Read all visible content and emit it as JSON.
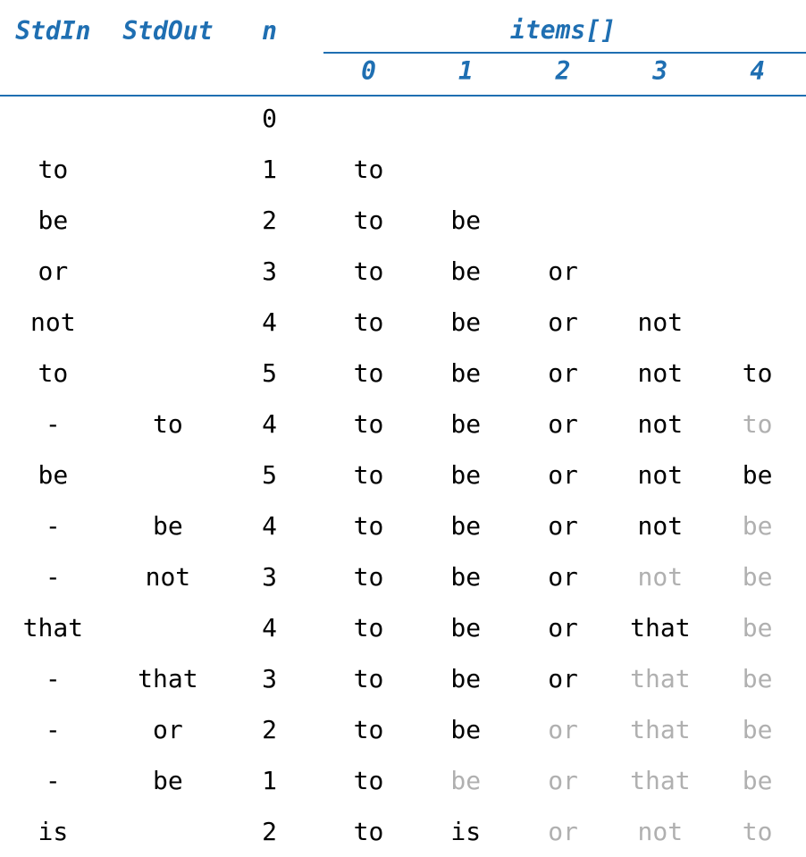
{
  "headers": {
    "stdin": "StdIn",
    "stdout": "StdOut",
    "n": "n",
    "items_label": "items[]",
    "indices": [
      "0",
      "1",
      "2",
      "3",
      "4"
    ]
  },
  "rows": [
    {
      "stdin": "",
      "stdout": "",
      "n": "0",
      "items": [
        {
          "v": "",
          "g": false
        },
        {
          "v": "",
          "g": false
        },
        {
          "v": "",
          "g": false
        },
        {
          "v": "",
          "g": false
        },
        {
          "v": "",
          "g": false
        }
      ]
    },
    {
      "stdin": "to",
      "stdout": "",
      "n": "1",
      "items": [
        {
          "v": "to",
          "g": false
        },
        {
          "v": "",
          "g": false
        },
        {
          "v": "",
          "g": false
        },
        {
          "v": "",
          "g": false
        },
        {
          "v": "",
          "g": false
        }
      ]
    },
    {
      "stdin": "be",
      "stdout": "",
      "n": "2",
      "items": [
        {
          "v": "to",
          "g": false
        },
        {
          "v": "be",
          "g": false
        },
        {
          "v": "",
          "g": false
        },
        {
          "v": "",
          "g": false
        },
        {
          "v": "",
          "g": false
        }
      ]
    },
    {
      "stdin": "or",
      "stdout": "",
      "n": "3",
      "items": [
        {
          "v": "to",
          "g": false
        },
        {
          "v": "be",
          "g": false
        },
        {
          "v": "or",
          "g": false
        },
        {
          "v": "",
          "g": false
        },
        {
          "v": "",
          "g": false
        }
      ]
    },
    {
      "stdin": "not",
      "stdout": "",
      "n": "4",
      "items": [
        {
          "v": "to",
          "g": false
        },
        {
          "v": "be",
          "g": false
        },
        {
          "v": "or",
          "g": false
        },
        {
          "v": "not",
          "g": false
        },
        {
          "v": "",
          "g": false
        }
      ]
    },
    {
      "stdin": "to",
      "stdout": "",
      "n": "5",
      "items": [
        {
          "v": "to",
          "g": false
        },
        {
          "v": "be",
          "g": false
        },
        {
          "v": "or",
          "g": false
        },
        {
          "v": "not",
          "g": false
        },
        {
          "v": "to",
          "g": false
        }
      ]
    },
    {
      "stdin": "-",
      "stdout": "to",
      "n": "4",
      "items": [
        {
          "v": "to",
          "g": false
        },
        {
          "v": "be",
          "g": false
        },
        {
          "v": "or",
          "g": false
        },
        {
          "v": "not",
          "g": false
        },
        {
          "v": "to",
          "g": true
        }
      ]
    },
    {
      "stdin": "be",
      "stdout": "",
      "n": "5",
      "items": [
        {
          "v": "to",
          "g": false
        },
        {
          "v": "be",
          "g": false
        },
        {
          "v": "or",
          "g": false
        },
        {
          "v": "not",
          "g": false
        },
        {
          "v": "be",
          "g": false
        }
      ]
    },
    {
      "stdin": "-",
      "stdout": "be",
      "n": "4",
      "items": [
        {
          "v": "to",
          "g": false
        },
        {
          "v": "be",
          "g": false
        },
        {
          "v": "or",
          "g": false
        },
        {
          "v": "not",
          "g": false
        },
        {
          "v": "be",
          "g": true
        }
      ]
    },
    {
      "stdin": "-",
      "stdout": "not",
      "n": "3",
      "items": [
        {
          "v": "to",
          "g": false
        },
        {
          "v": "be",
          "g": false
        },
        {
          "v": "or",
          "g": false
        },
        {
          "v": "not",
          "g": true
        },
        {
          "v": "be",
          "g": true
        }
      ]
    },
    {
      "stdin": "that",
      "stdout": "",
      "n": "4",
      "items": [
        {
          "v": "to",
          "g": false
        },
        {
          "v": "be",
          "g": false
        },
        {
          "v": "or",
          "g": false
        },
        {
          "v": "that",
          "g": false
        },
        {
          "v": "be",
          "g": true
        }
      ]
    },
    {
      "stdin": "-",
      "stdout": "that",
      "n": "3",
      "items": [
        {
          "v": "to",
          "g": false
        },
        {
          "v": "be",
          "g": false
        },
        {
          "v": "or",
          "g": false
        },
        {
          "v": "that",
          "g": true
        },
        {
          "v": "be",
          "g": true
        }
      ]
    },
    {
      "stdin": "-",
      "stdout": "or",
      "n": "2",
      "items": [
        {
          "v": "to",
          "g": false
        },
        {
          "v": "be",
          "g": false
        },
        {
          "v": "or",
          "g": true
        },
        {
          "v": "that",
          "g": true
        },
        {
          "v": "be",
          "g": true
        }
      ]
    },
    {
      "stdin": "-",
      "stdout": "be",
      "n": "1",
      "items": [
        {
          "v": "to",
          "g": false
        },
        {
          "v": "be",
          "g": true
        },
        {
          "v": "or",
          "g": true
        },
        {
          "v": "that",
          "g": true
        },
        {
          "v": "be",
          "g": true
        }
      ]
    },
    {
      "stdin": "is",
      "stdout": "",
      "n": "2",
      "items": [
        {
          "v": "to",
          "g": false
        },
        {
          "v": "is",
          "g": false
        },
        {
          "v": "or",
          "g": true
        },
        {
          "v": "not",
          "g": true
        },
        {
          "v": "to",
          "g": true
        }
      ]
    }
  ]
}
